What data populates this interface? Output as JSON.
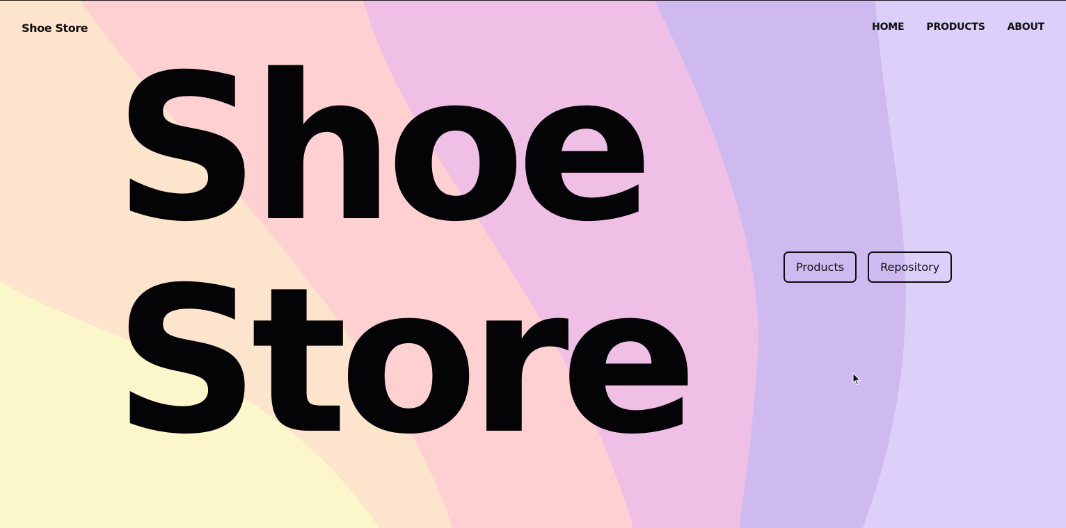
{
  "header": {
    "brand": "Shoe Store",
    "nav": [
      {
        "label": "HOME"
      },
      {
        "label": "PRODUCTS"
      },
      {
        "label": "ABOUT"
      }
    ]
  },
  "hero": {
    "line1": "Shoe",
    "line2": "Store"
  },
  "actions": {
    "products_label": "Products",
    "repository_label": "Repository"
  },
  "colors": {
    "band_yellow": "#fbf7cb",
    "band_peach": "#fde4cd",
    "band_pink": "#fed0d2",
    "band_magenta": "#f0bfe6",
    "band_purple": "#cfbaf0",
    "band_lavender": "#dcd0fb",
    "text": "#040406"
  },
  "icons": {
    "cursor": "mouse-pointer-icon"
  }
}
